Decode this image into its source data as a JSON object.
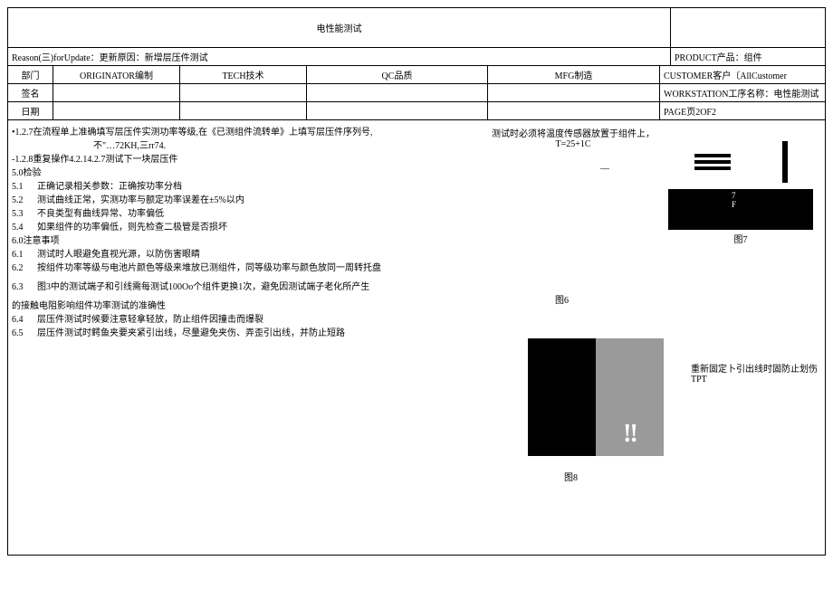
{
  "title": "电性能测试",
  "reason": "Reason(三)forUpdate：更新原因：新增层压件测试",
  "product": "PRODUCT产品：组件",
  "header": {
    "dept": "部门",
    "originator": "ORIGINATOR编制",
    "tech": "TECH技术",
    "qc": "QC品质",
    "mfg": "MFG制造",
    "customer": "CUSTOMER客户〔AllCustomer",
    "sign": "签名",
    "workstation": "WORKSTATION工序名称：电性能测试",
    "date": "日期",
    "page": "PAGE页2OF2"
  },
  "body": {
    "p127": "•1.2.7在流程单上准确填写层压件实测功率等级,在《已测组件流转单》上填写层压件序列号,",
    "p127b": "不\"…72KH,三rr74.",
    "p128": "-1.2.8重复操作4.2.14.2.7测试下一块层压件",
    "s50": "5.0检验",
    "s51n": "5.1",
    "s51": "正确记录相关参数：正确按功率分档",
    "s52n": "5.2",
    "s52": "测试曲线正常，实测功率与额定功率误差在±5%以内",
    "s53n": "5.3",
    "s53": "不良类型有曲线异常、功率偏低",
    "s54n": "5.4",
    "s54": "如果组件的功率偏低，则先检查二极管是否损坏",
    "s60": "6.0注意事项",
    "s61n": "6.1",
    "s61": "测试时人眼避免直视光源，以防伤害眼睛",
    "s62n": "6.2",
    "s62": "按组件功率等级与电池片颜色等级来堆放已测组件，同等级功率与颜色放同一周转托盘",
    "s63n": "6.3",
    "s63": "图3中的测试端子和引线需每测试100Oo个组件更换1次，避免因测试端子老化所产生",
    "s63b": "的接触电阻影响组件功率测试的准确性",
    "s64n": "6.4",
    "s64": "层压件测试时候要注意轻拿轻放，防止组件因撞击而爆裂",
    "s65n": "6.5",
    "s65": "层压件测试时鳄鱼夹要夹紧引出线，尽量避免夹伤、弄歪引出线，并防止短路"
  },
  "notes": {
    "fig6": "测试时必须将温度传感器放置于组件上，T=25+1C",
    "fig6dash": "—",
    "fig6label": "图6",
    "fig7label": "图7",
    "fig7num": "7",
    "fig7f": "F",
    "fig8label": "图8",
    "fig8dots": "!!",
    "fig8note": "重新固定卜引出线时固防止划伤TPT"
  }
}
